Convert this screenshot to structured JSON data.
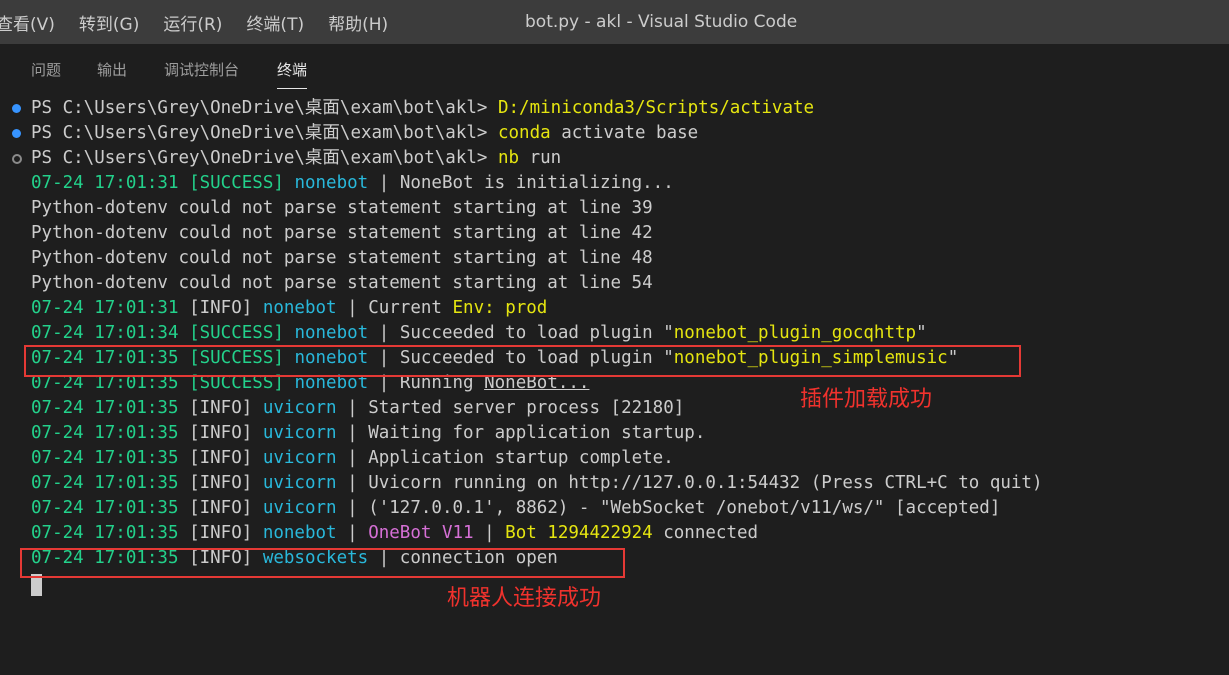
{
  "menu": [
    "查看(V)",
    "转到(G)",
    "运行(R)",
    "终端(T)",
    "帮助(H)"
  ],
  "window_title": "bot.py - akl - Visual Studio Code",
  "tabs": [
    "问题",
    "输出",
    "调试控制台",
    "终端"
  ],
  "active_tab": "终端",
  "terminal": {
    "prompt": "PS C:\\Users\\Grey\\OneDrive\\桌面\\exam\\bot\\akl>",
    "commands": [
      {
        "cmd": "D:/miniconda3/Scripts/activate",
        "arg": ""
      },
      {
        "cmd": "conda",
        "arg": " activate base"
      },
      {
        "cmd": "nb",
        "arg": " run"
      }
    ],
    "log0": {
      "ts": "07-24 17:01:31",
      "lvl": "[SUCCESS]",
      "src": "nonebot",
      "msg": "NoneBot is initializing..."
    },
    "dotenv": [
      "Python-dotenv could not parse statement starting at line 39",
      "Python-dotenv could not parse statement starting at line 42",
      "Python-dotenv could not parse statement starting at line 48",
      "Python-dotenv could not parse statement starting at line 54"
    ],
    "log_env": {
      "ts": "07-24 17:01:31",
      "lvl": "[INFO]",
      "src": "nonebot",
      "msg": "Current ",
      "env_label": "Env:",
      "env_val": "prod"
    },
    "log_p1": {
      "ts": "07-24 17:01:34",
      "lvl": "[SUCCESS]",
      "src": "nonebot",
      "msg": "Succeeded to load plugin \"",
      "plugin": "nonebot_plugin_gocqhttp",
      "end": "\""
    },
    "log_p2": {
      "ts": "07-24 17:01:35",
      "lvl": "[SUCCESS]",
      "src": "nonebot",
      "msg": "Succeeded to load plugin \"",
      "plugin": "nonebot_plugin_simplemusic",
      "end": "\""
    },
    "log_run": {
      "ts": "07-24 17:01:35",
      "lvl": "[SUCCESS]",
      "src": "nonebot",
      "msg": "Running ",
      "under": "NoneBot..."
    },
    "uvicorn": [
      {
        "ts": "07-24 17:01:35",
        "lvl": "[INFO]",
        "src": "uvicorn",
        "msg": "Started server process [22180]"
      },
      {
        "ts": "07-24 17:01:35",
        "lvl": "[INFO]",
        "src": "uvicorn",
        "msg": "Waiting for application startup."
      },
      {
        "ts": "07-24 17:01:35",
        "lvl": "[INFO]",
        "src": "uvicorn",
        "msg": "Application startup complete."
      },
      {
        "ts": "07-24 17:01:35",
        "lvl": "[INFO]",
        "src": "uvicorn",
        "msg": "Uvicorn running on http://127.0.0.1:54432 (Press CTRL+C to quit)"
      },
      {
        "ts": "07-24 17:01:35",
        "lvl": "[INFO]",
        "src": "uvicorn",
        "msg": "('127.0.0.1', 8862) - \"WebSocket /onebot/v11/ws/\" [accepted]"
      }
    ],
    "log_bot": {
      "ts": "07-24 17:01:35",
      "lvl": "[INFO]",
      "src": "nonebot",
      "adapter": "OneBot V11",
      "bot": "Bot 1294422924",
      "msg": " connected"
    },
    "log_ws": {
      "ts": "07-24 17:01:35",
      "lvl": "[INFO]",
      "src": "websockets",
      "msg": "connection open"
    },
    "sep": " | "
  },
  "annotations": {
    "plugin_ok": "插件加载成功",
    "bot_ok": "机器人连接成功"
  },
  "colors": {
    "timestamp": "#23d18b",
    "source": "#29b8db",
    "highlight": "#e5e510",
    "adapter": "#d670d6",
    "annotation": "#f0322d"
  }
}
